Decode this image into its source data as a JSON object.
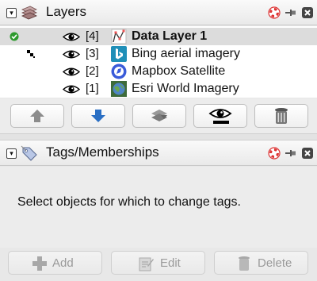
{
  "layers_panel": {
    "title": "Layers",
    "layers": [
      {
        "index": "[4]",
        "name": "Data Layer 1",
        "selected": true,
        "active": true,
        "icon": "data-layer-icon"
      },
      {
        "index": "[3]",
        "name": "Bing aerial imagery",
        "selected": false,
        "active": false,
        "icon": "bing-logo-icon"
      },
      {
        "index": "[2]",
        "name": "Mapbox Satellite",
        "selected": false,
        "active": false,
        "icon": "mapbox-logo-icon"
      },
      {
        "index": "[1]",
        "name": "Esri World Imagery",
        "selected": false,
        "active": false,
        "icon": "esri-globe-icon"
      }
    ],
    "buttons": [
      "move-up",
      "move-down",
      "merge",
      "toggle-visibility",
      "delete"
    ]
  },
  "tags_panel": {
    "title": "Tags/Memberships",
    "message": "Select objects for which to change tags.",
    "add_label": "Add",
    "edit_label": "Edit",
    "delete_label": "Delete"
  },
  "colors": {
    "selected_row": "#dcdcdc",
    "active_check": "#2e9a2e",
    "down_arrow": "#2a6fc4",
    "disabled_text": "#9a9a9a"
  }
}
